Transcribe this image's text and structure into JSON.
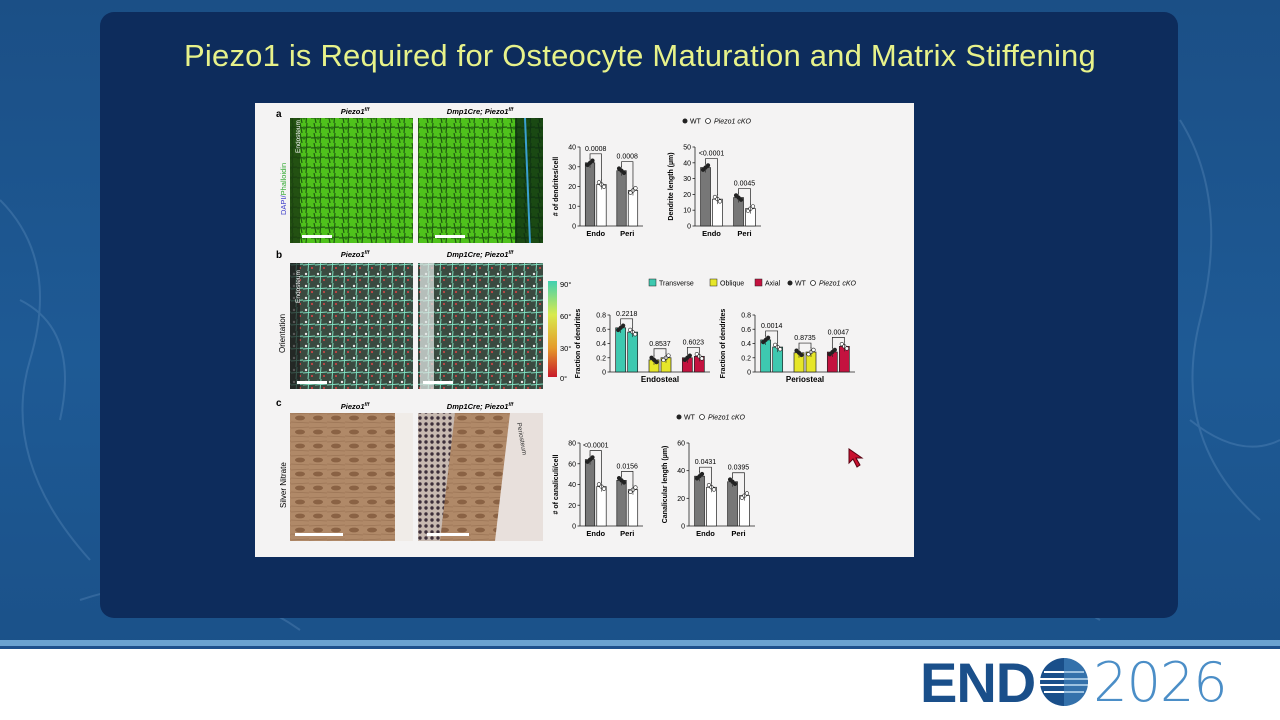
{
  "slide": {
    "title": "Piezo1 is Required for Osteocyte Maturation and Matrix Stiffening"
  },
  "colors": {
    "panel": "#0d2c5c",
    "title": "#e7f28a",
    "wt": "#7a7a7a",
    "cko": "#ffffff",
    "transverse": "#3ec9b0",
    "oblique": "#e6e629",
    "axial": "#c4123f"
  },
  "figure": {
    "row_a": {
      "letter": "a",
      "img1_title": "Piezo1",
      "img1_sup": "f/f",
      "img2_title": "Dmp1Cre; Piezo1",
      "img2_sup": "f/f",
      "side_label_dapi": "DAPI/",
      "side_label_phalloidin": "Phalloidin",
      "endosteum": "Endosteum",
      "legend_wt": "WT",
      "legend_cko": "Piezo1 cKO",
      "chart1": {
        "ylabel": "# of dendrites/cell",
        "yticks": [
          "0",
          "10",
          "20",
          "30",
          "40"
        ],
        "categories": [
          "Endo",
          "Peri"
        ],
        "pvalues": [
          "0.0008",
          "0.0008"
        ]
      },
      "chart2": {
        "ylabel": "Dendrite length (µm)",
        "yticks": [
          "0",
          "10",
          "20",
          "30",
          "40",
          "50"
        ],
        "categories": [
          "Endo",
          "Peri"
        ],
        "pvalues": [
          "<0.0001",
          "0.0045"
        ]
      }
    },
    "row_b": {
      "letter": "b",
      "img1_title": "Piezo1",
      "img1_sup": "f/f",
      "img2_title": "Dmp1Cre; Piezo1",
      "img2_sup": "f/f",
      "side_label": "Orientation",
      "endosteum": "Endosteum",
      "scale_ticks": [
        "90°",
        "60°",
        "30°",
        "0°"
      ],
      "legend": {
        "transverse": "Transverse",
        "oblique": "Oblique",
        "axial": "Axial",
        "wt": "WT",
        "cko": "Piezo1 cKO"
      },
      "chart_endo": {
        "ylabel": "Fraction of dendrites",
        "xlabel": "Endosteal",
        "yticks": [
          "0",
          "0.2",
          "0.4",
          "0.6",
          "0.8"
        ],
        "pvalues": [
          "0.2218",
          "0.8537",
          "0.6023"
        ]
      },
      "chart_peri": {
        "ylabel": "Fraction of dendrites",
        "xlabel": "Periosteal",
        "yticks": [
          "0",
          "0.2",
          "0.4",
          "0.6",
          "0.8"
        ],
        "pvalues": [
          "0.0014",
          "0.8735",
          "0.0047"
        ]
      }
    },
    "row_c": {
      "letter": "c",
      "img1_title": "Piezo1",
      "img1_sup": "f/f",
      "img2_title": "Dmp1Cre; Piezo1",
      "img2_sup": "f/f",
      "side_label": "Silver Nitrate",
      "periosteum": "Periosteum",
      "legend_wt": "WT",
      "legend_cko": "Piezo1 cKO",
      "chart1": {
        "ylabel": "# of canaliculi/cell",
        "yticks": [
          "0",
          "20",
          "40",
          "60",
          "80"
        ],
        "categories": [
          "Endo",
          "Peri"
        ],
        "pvalues": [
          "<0.0001",
          "0.0156"
        ]
      },
      "chart2": {
        "ylabel": "Canalicular length (µm)",
        "yticks": [
          "0",
          "20",
          "40",
          "60"
        ],
        "categories": [
          "Endo",
          "Peri"
        ],
        "pvalues": [
          "0.0431",
          "0.0395"
        ]
      }
    }
  },
  "chart_data": [
    {
      "type": "bar",
      "ylabel": "# of dendrites/cell",
      "categories": [
        "Endo",
        "Peri"
      ],
      "ylim": [
        0,
        40
      ],
      "series": [
        {
          "name": "WT",
          "values": [
            32,
            28
          ]
        },
        {
          "name": "Piezo1 cKO",
          "values": [
            21,
            18
          ]
        }
      ]
    },
    {
      "type": "bar",
      "ylabel": "Dendrite length (µm)",
      "categories": [
        "Endo",
        "Peri"
      ],
      "ylim": [
        0,
        50
      ],
      "series": [
        {
          "name": "WT",
          "values": [
            37,
            18
          ]
        },
        {
          "name": "Piezo1 cKO",
          "values": [
            17,
            11
          ]
        }
      ]
    },
    {
      "type": "bar",
      "ylabel": "Fraction of dendrites",
      "xlabel": "Endosteal",
      "categories": [
        "Transverse",
        "Oblique",
        "Axial"
      ],
      "ylim": [
        0,
        0.8
      ],
      "series": [
        {
          "name": "WT",
          "values": [
            0.62,
            0.17,
            0.2
          ]
        },
        {
          "name": "Piezo1 cKO",
          "values": [
            0.56,
            0.2,
            0.22
          ]
        }
      ]
    },
    {
      "type": "bar",
      "ylabel": "Fraction of dendrites",
      "xlabel": "Periosteal",
      "categories": [
        "Transverse",
        "Oblique",
        "Axial"
      ],
      "ylim": [
        0,
        0.8
      ],
      "series": [
        {
          "name": "WT",
          "values": [
            0.45,
            0.27,
            0.28
          ]
        },
        {
          "name": "Piezo1 cKO",
          "values": [
            0.35,
            0.28,
            0.36
          ]
        }
      ]
    },
    {
      "type": "bar",
      "ylabel": "# of canaliculi/cell",
      "categories": [
        "Endo",
        "Peri"
      ],
      "ylim": [
        0,
        80
      ],
      "series": [
        {
          "name": "WT",
          "values": [
            64,
            44
          ]
        },
        {
          "name": "Piezo1 cKO",
          "values": [
            38,
            35
          ]
        }
      ]
    },
    {
      "type": "bar",
      "ylabel": "Canalicular length (µm)",
      "categories": [
        "Endo",
        "Peri"
      ],
      "ylim": [
        0,
        60
      ],
      "series": [
        {
          "name": "WT",
          "values": [
            36,
            32
          ]
        },
        {
          "name": "Piezo1 cKO",
          "values": [
            28,
            22
          ]
        }
      ]
    }
  ],
  "footer": {
    "logo_bold": "END",
    "logo_light": "2026"
  }
}
